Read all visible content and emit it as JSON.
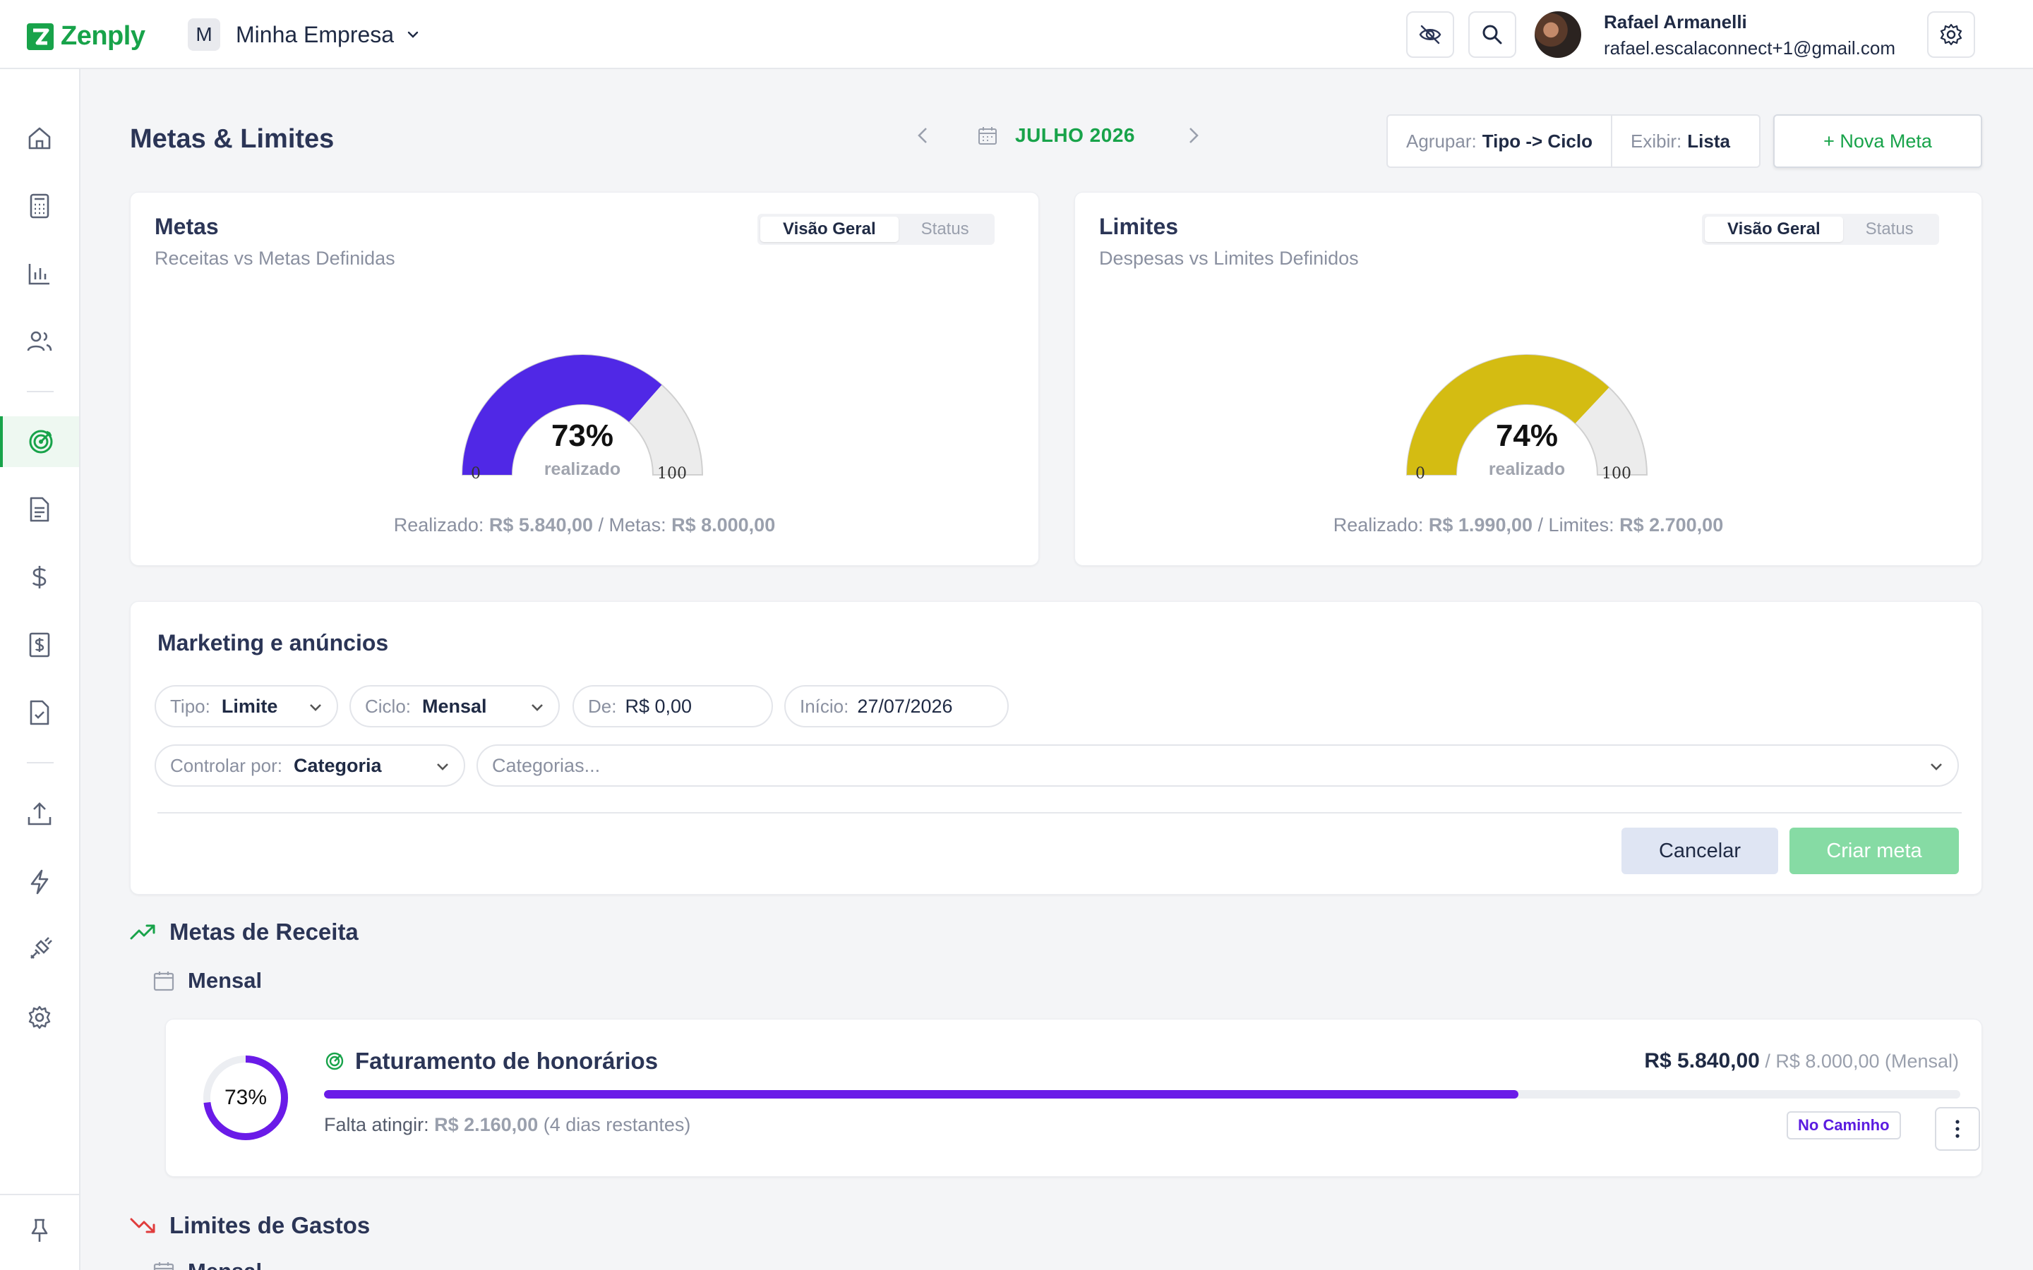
{
  "app": {
    "logo_text": "Zenply",
    "brand_color": "#18a34a"
  },
  "company": {
    "initial": "M",
    "name": "Minha Empresa"
  },
  "user": {
    "name": "Rafael Armanelli",
    "email": "rafael.escalaconnect+1@gmail.com"
  },
  "page": {
    "title": "Metas & Limites",
    "month": "JULHO 2026",
    "group_label": "Agrupar:",
    "group_value": "Tipo -> Ciclo",
    "display_label": "Exibir:",
    "display_value": "Lista",
    "new_goal": "+ Nova Meta"
  },
  "metas_card": {
    "title": "Metas",
    "subtitle": "Receitas vs Metas Definidas",
    "tab_overview": "Visão Geral",
    "tab_status": "Status",
    "percent": 73,
    "percent_text": "73%",
    "realized_label": "realizado",
    "min": "0",
    "max": "100",
    "color": "#5028e6",
    "footer_realized_label": "Realizado:",
    "footer_realized_value": "R$ 5.840,00",
    "footer_sep": "/",
    "footer_target_label": "Metas:",
    "footer_target_value": "R$ 8.000,00"
  },
  "limites_card": {
    "title": "Limites",
    "subtitle": "Despesas vs Limites Definidos",
    "tab_overview": "Visão Geral",
    "tab_status": "Status",
    "percent": 74,
    "percent_text": "74%",
    "realized_label": "realizado",
    "min": "0",
    "max": "100",
    "color": "#d4bc12",
    "footer_realized_label": "Realizado:",
    "footer_realized_value": "R$ 1.990,00",
    "footer_sep": "/",
    "footer_target_label": "Limites:",
    "footer_target_value": "R$ 2.700,00"
  },
  "form": {
    "title": "Marketing e anúncios",
    "tipo_label": "Tipo:",
    "tipo_value": "Limite",
    "ciclo_label": "Ciclo:",
    "ciclo_value": "Mensal",
    "de_label": "De:",
    "de_value": "R$ 0,00",
    "inicio_label": "Início:",
    "inicio_value": "27/07/2026",
    "controlar_label": "Controlar por:",
    "controlar_value": "Categoria",
    "categorias_placeholder": "Categorias...",
    "cancel": "Cancelar",
    "create": "Criar meta"
  },
  "sections": {
    "revenue_title": "Metas de Receita",
    "revenue_cycle": "Mensal",
    "expense_title": "Limites de Gastos",
    "expense_cycle": "Mensal"
  },
  "goal_item": {
    "name": "Faturamento de honorários",
    "percent": 73,
    "percent_text": "73%",
    "amount": "R$ 5.840,00",
    "target": "/ R$ 8.000,00 (Mensal)",
    "remaining_label": "Falta atingir:",
    "remaining_value": "R$ 2.160,00",
    "remaining_days": "(4 dias restantes)",
    "status": "No Caminho",
    "bar_color": "#6a1be8"
  },
  "icons": {
    "sidebar": [
      "home-icon",
      "calculator-icon",
      "chart-icon",
      "users-icon",
      "goals-icon",
      "document-icon",
      "dollar-icon",
      "invoice-icon",
      "checklist-icon",
      "upload-icon",
      "lightning-icon",
      "plug-icon",
      "settings-icon",
      "pin-icon"
    ]
  }
}
